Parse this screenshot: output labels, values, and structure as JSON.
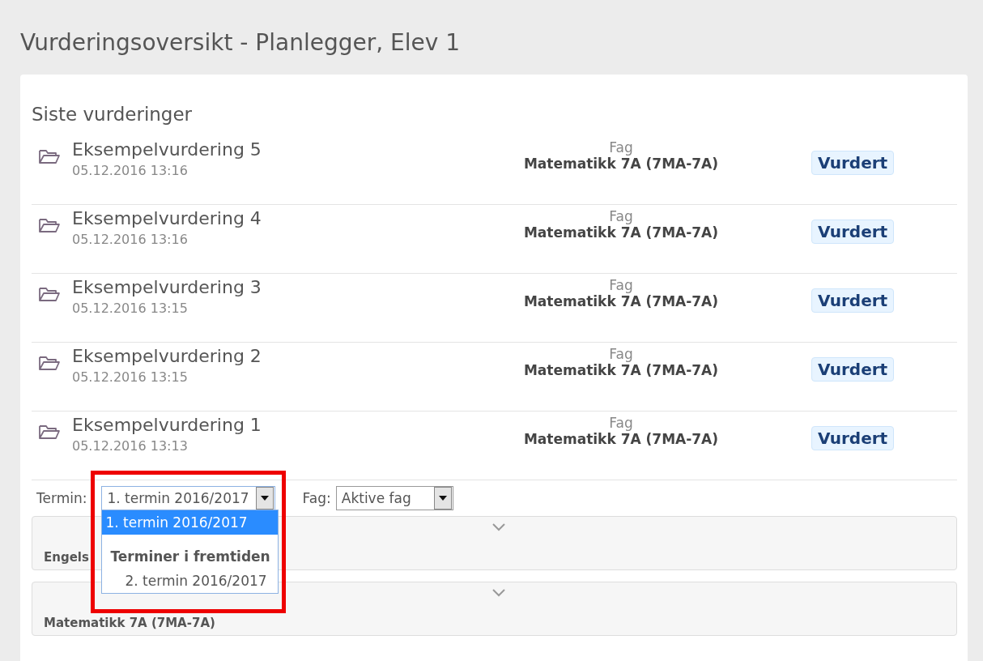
{
  "page_title": "Vurderingsoversikt - Planlegger, Elev 1",
  "section_title": "Siste vurderinger",
  "assessments": [
    {
      "name": "Eksempelvurdering 5",
      "date": "05.12.2016 13:16",
      "subject_label": "Fag",
      "subject": "Matematikk 7A (7MA-7A)",
      "status": "Vurdert"
    },
    {
      "name": "Eksempelvurdering 4",
      "date": "05.12.2016 13:16",
      "subject_label": "Fag",
      "subject": "Matematikk 7A (7MA-7A)",
      "status": "Vurdert"
    },
    {
      "name": "Eksempelvurdering 3",
      "date": "05.12.2016 13:15",
      "subject_label": "Fag",
      "subject": "Matematikk 7A (7MA-7A)",
      "status": "Vurdert"
    },
    {
      "name": "Eksempelvurdering 2",
      "date": "05.12.2016 13:15",
      "subject_label": "Fag",
      "subject": "Matematikk 7A (7MA-7A)",
      "status": "Vurdert"
    },
    {
      "name": "Eksempelvurdering 1",
      "date": "05.12.2016 13:13",
      "subject_label": "Fag",
      "subject": "Matematikk 7A (7MA-7A)",
      "status": "Vurdert"
    }
  ],
  "filters": {
    "term_label": "Termin:",
    "term_value": "1. termin 2016/2017",
    "subject_label": "Fag:",
    "subject_value": "Aktive fag"
  },
  "term_dropdown": {
    "open": true,
    "items": [
      {
        "kind": "option",
        "label": "1. termin 2016/2017",
        "selected": true
      },
      {
        "kind": "spacer"
      },
      {
        "kind": "group",
        "label": "Terminer i fremtiden"
      },
      {
        "kind": "option",
        "label": "2. termin 2016/2017",
        "selected": false
      }
    ]
  },
  "subject_panels": [
    {
      "title": "Engels"
    },
    {
      "title": "Matematikk 7A (7MA-7A)"
    }
  ]
}
